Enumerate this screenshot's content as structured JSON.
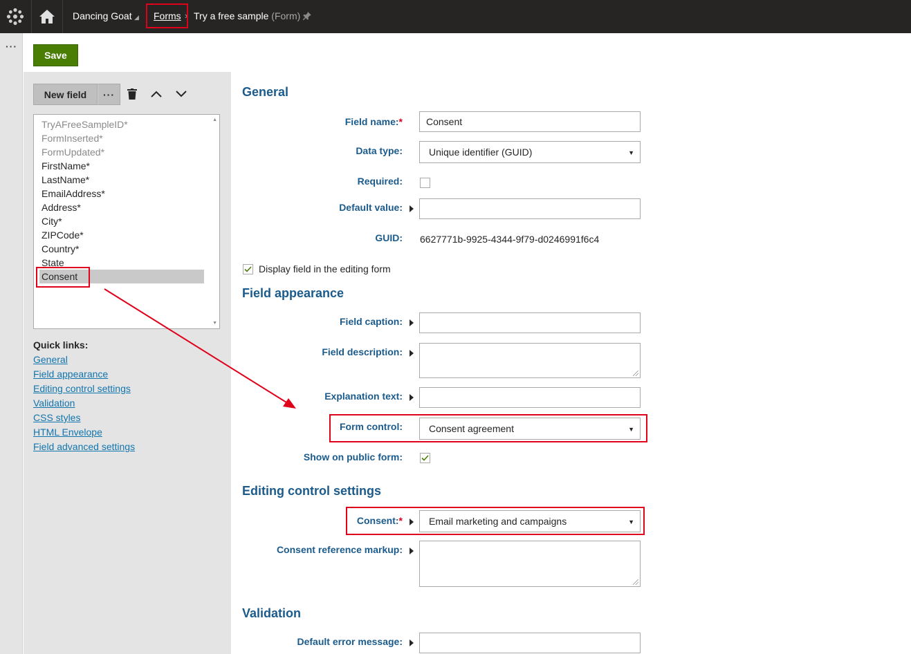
{
  "topbar": {
    "site": "Dancing Goat",
    "forms": "Forms",
    "title": "Try a free sample",
    "title_sub": "(Form)"
  },
  "toolbar": {
    "save_label": "Save"
  },
  "panel": {
    "new_field_label": "New field",
    "more_label": "···",
    "fields": [
      {
        "name": "TryAFreeSampleID*",
        "system": true
      },
      {
        "name": "FormInserted*",
        "system": true
      },
      {
        "name": "FormUpdated*",
        "system": true
      },
      {
        "name": "FirstName*",
        "system": false
      },
      {
        "name": "LastName*",
        "system": false
      },
      {
        "name": "EmailAddress*",
        "system": false
      },
      {
        "name": "Address*",
        "system": false
      },
      {
        "name": "City*",
        "system": false
      },
      {
        "name": "ZIPCode*",
        "system": false
      },
      {
        "name": "Country*",
        "system": false
      },
      {
        "name": "State",
        "system": false
      },
      {
        "name": "Consent",
        "system": false,
        "selected": true
      }
    ],
    "quick_links_title": "Quick links:",
    "quick_links": [
      "General",
      "Field appearance",
      "Editing control settings",
      "Validation",
      "CSS styles",
      "HTML Envelope",
      "Field advanced settings"
    ]
  },
  "general": {
    "heading": "General",
    "field_name_label": "Field name:",
    "field_name_value": "Consent",
    "data_type_label": "Data type:",
    "data_type_value": "Unique identifier (GUID)",
    "required_label": "Required:",
    "default_value_label": "Default value:",
    "guid_label": "GUID:",
    "guid_value": "6627771b-9925-4344-9f79-d0246991f6c4",
    "display_field_label": "Display field in the editing form"
  },
  "appearance": {
    "heading": "Field appearance",
    "caption_label": "Field caption:",
    "description_label": "Field description:",
    "explanation_label": "Explanation text:",
    "form_control_label": "Form control:",
    "form_control_value": "Consent agreement",
    "show_public_label": "Show on public form:"
  },
  "editing": {
    "heading": "Editing control settings",
    "consent_label": "Consent:",
    "consent_value": "Email marketing and campaigns",
    "markup_label": "Consent reference markup:"
  },
  "validation": {
    "heading": "Validation",
    "error_label": "Default error message:"
  },
  "colors": {
    "topbar": "#262524",
    "accent_blue": "#1b5b8c",
    "save_green": "#497d04",
    "highlight_red": "#e0001a"
  }
}
